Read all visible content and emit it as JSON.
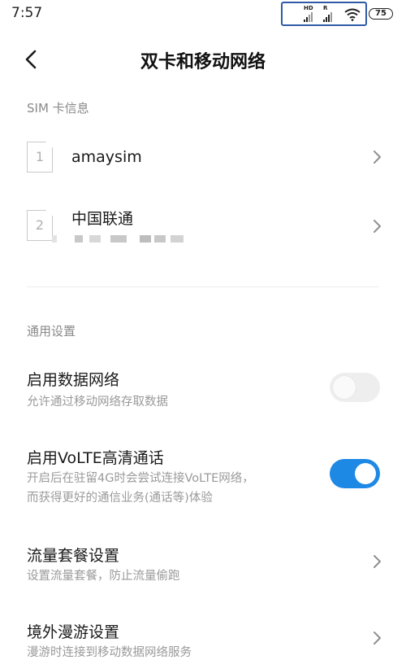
{
  "status_bar": {
    "time": "7:57",
    "sim1_label": "HD",
    "sim2_label": "R",
    "battery": "75",
    "wifi_icon": "wifi-icon"
  },
  "header": {
    "title": "双卡和移动网络",
    "back_icon": "back-arrow-icon"
  },
  "sim_section": {
    "heading": "SIM 卡信息",
    "items": [
      {
        "slot": "1",
        "name": "amaysim",
        "icon": "sim-card-icon"
      },
      {
        "slot": "2",
        "name": "中国联通",
        "icon": "sim-card-icon"
      }
    ]
  },
  "general_section": {
    "heading": "通用设置",
    "items": [
      {
        "title": "启用数据网络",
        "subtitle": "允许通过移动网络存取数据",
        "control": "toggle",
        "on": false
      },
      {
        "title": "启用VoLTE高清通话",
        "subtitle1": "开启后在驻留4G时会尝试连接VoLTE网络，",
        "subtitle2": "而获得更好的通信业务(通话等)体验",
        "control": "toggle",
        "on": true
      },
      {
        "title": "流量套餐设置",
        "subtitle": "设置流量套餐，防止流量偷跑",
        "control": "chevron"
      },
      {
        "title": "境外漫游设置",
        "subtitle": "漫游时连接到移动数据网络服务",
        "control": "chevron"
      }
    ]
  },
  "colors": {
    "accent": "#1e88e5",
    "status_highlight": "#2f5aa8",
    "section_heading": "#8a8a8a",
    "subtitle": "#9a9a9a"
  }
}
